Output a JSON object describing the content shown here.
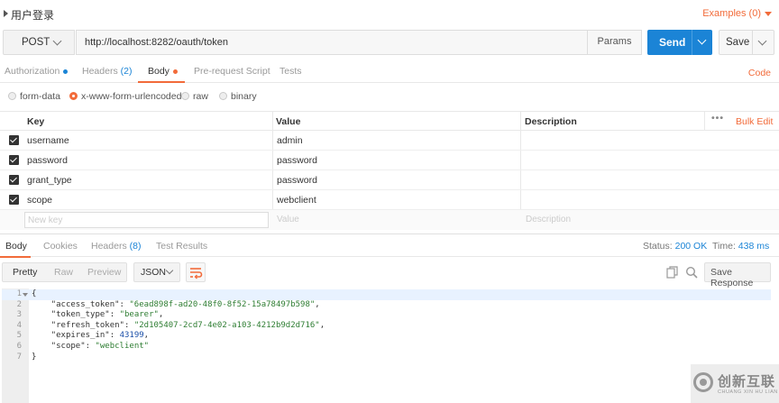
{
  "request": {
    "name": "用户登录",
    "examples_label": "Examples (0)",
    "method": "POST",
    "url": "http://localhost:8282/oauth/token",
    "params_label": "Params",
    "send_label": "Send",
    "save_label": "Save"
  },
  "request_tabs": [
    {
      "label": "Authorization",
      "dot": true
    },
    {
      "label": "Headers",
      "count": "(2)"
    },
    {
      "label": "Body",
      "dot": true,
      "active": true
    },
    {
      "label": "Pre-request Script"
    },
    {
      "label": "Tests"
    }
  ],
  "code_link": "Code",
  "body_types": [
    "form-data",
    "x-www-form-urlencoded",
    "raw",
    "binary"
  ],
  "body_type_selected": "x-www-form-urlencoded",
  "kv_table": {
    "headers": {
      "key": "Key",
      "value": "Value",
      "description": "Description",
      "more": "•••",
      "bulk_edit": "Bulk Edit"
    },
    "rows": [
      {
        "key": "username",
        "value": "admin",
        "checked": true
      },
      {
        "key": "password",
        "value": "password",
        "checked": true
      },
      {
        "key": "grant_type",
        "value": "password",
        "checked": true
      },
      {
        "key": "scope",
        "value": "webclient",
        "checked": true
      }
    ],
    "placeholders": {
      "key": "New key",
      "value": "Value",
      "description": "Description"
    }
  },
  "response_tabs": [
    {
      "label": "Body",
      "active": true
    },
    {
      "label": "Cookies"
    },
    {
      "label": "Headers",
      "count": "(8)"
    },
    {
      "label": "Test Results"
    }
  ],
  "response_status": {
    "status_label": "Status:",
    "status_value": "200 OK",
    "time_label": "Time:",
    "time_value": "438 ms"
  },
  "response_toolbar": {
    "views": [
      "Pretty",
      "Raw",
      "Preview"
    ],
    "active_view": "Pretty",
    "format": "JSON",
    "save_response_label": "Save Response"
  },
  "response_body": {
    "line_numbers": [
      "1",
      "2",
      "3",
      "4",
      "5",
      "6",
      "7"
    ],
    "open_brace": "{",
    "close_brace": "}",
    "entries": [
      {
        "key": "\"access_token\"",
        "value": "\"6ead898f-ad20-48f0-8f52-15a78497b598\"",
        "sep": ","
      },
      {
        "key": "\"token_type\"",
        "value": "\"bearer\"",
        "sep": ","
      },
      {
        "key": "\"refresh_token\"",
        "value": "\"2d105407-2cd7-4e02-a103-4212b9d2d716\"",
        "sep": ","
      },
      {
        "key": "\"expires_in\"",
        "value": "43199",
        "sep": ","
      },
      {
        "key": "\"scope\"",
        "value": "\"webclient\"",
        "sep": ""
      }
    ]
  },
  "watermark": {
    "cn": "创新互联",
    "en": "CHUANG XIN HU LIAN"
  },
  "colors": {
    "accent": "#f26b3a",
    "primary": "#1b84d6"
  }
}
